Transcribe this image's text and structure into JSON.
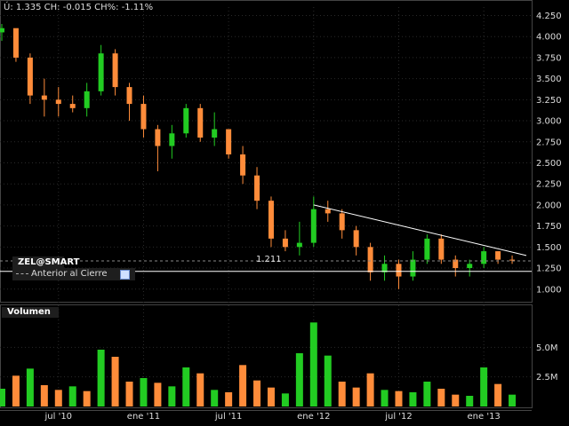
{
  "header": {
    "info_text": "Ú: 1.335 CH: -0.015 CH%: -1.11%"
  },
  "price_panel": {
    "symbol": "ZEL@SMART",
    "legend_label": "Anterior al Cierre",
    "prev_close_value": "1.211"
  },
  "volume_panel": {
    "title": "Volumen"
  },
  "colors": {
    "up": "#22cc22",
    "down": "#ff8c3a",
    "grid": "#2a2a2a",
    "trendline": "#ffffff"
  },
  "chart_data": [
    {
      "type": "candlestick",
      "title": "",
      "ylim": [
        0.85,
        4.35
      ],
      "y_ticks": [
        "1.000",
        "1.250",
        "1.500",
        "1.750",
        "2.000",
        "2.250",
        "2.500",
        "2.750",
        "3.000",
        "3.250",
        "3.500",
        "3.750",
        "4.000",
        "4.250"
      ],
      "x_ticks": [
        "jul '10",
        "ene '11",
        "jul '11",
        "ene '12",
        "jul '12",
        "ene '13"
      ],
      "x_range": [
        "2010-03",
        "2013-04"
      ],
      "previous_close": 1.211,
      "close_reference_line": 1.335,
      "trendline": [
        [
          "2012-01",
          2.0
        ],
        [
          "2013-04",
          1.4
        ]
      ],
      "series": [
        {
          "values": [
            {
              "x": "2010-03",
              "o": 4.05,
              "h": 4.15,
              "l": 3.95,
              "c": 4.1
            },
            {
              "x": "2010-04",
              "o": 4.1,
              "h": 4.05,
              "l": 3.7,
              "c": 3.75
            },
            {
              "x": "2010-05",
              "o": 3.75,
              "h": 3.8,
              "l": 3.2,
              "c": 3.3
            },
            {
              "x": "2010-06",
              "o": 3.3,
              "h": 3.5,
              "l": 3.05,
              "c": 3.25
            },
            {
              "x": "2010-07",
              "o": 3.25,
              "h": 3.4,
              "l": 3.05,
              "c": 3.2
            },
            {
              "x": "2010-08",
              "o": 3.2,
              "h": 3.3,
              "l": 3.1,
              "c": 3.15
            },
            {
              "x": "2010-09",
              "o": 3.15,
              "h": 3.45,
              "l": 3.05,
              "c": 3.35
            },
            {
              "x": "2010-10",
              "o": 3.35,
              "h": 3.9,
              "l": 3.3,
              "c": 3.8
            },
            {
              "x": "2010-11",
              "o": 3.8,
              "h": 3.85,
              "l": 3.3,
              "c": 3.4
            },
            {
              "x": "2010-12",
              "o": 3.4,
              "h": 3.45,
              "l": 3.0,
              "c": 3.2
            },
            {
              "x": "2011-01",
              "o": 3.2,
              "h": 3.3,
              "l": 2.8,
              "c": 2.9
            },
            {
              "x": "2011-02",
              "o": 2.9,
              "h": 2.95,
              "l": 2.4,
              "c": 2.7
            },
            {
              "x": "2011-03",
              "o": 2.7,
              "h": 2.95,
              "l": 2.55,
              "c": 2.85
            },
            {
              "x": "2011-04",
              "o": 2.85,
              "h": 3.2,
              "l": 2.8,
              "c": 3.15
            },
            {
              "x": "2011-05",
              "o": 3.15,
              "h": 3.2,
              "l": 2.75,
              "c": 2.8
            },
            {
              "x": "2011-06",
              "o": 2.8,
              "h": 3.1,
              "l": 2.7,
              "c": 2.9
            },
            {
              "x": "2011-07",
              "o": 2.9,
              "h": 2.9,
              "l": 2.55,
              "c": 2.6
            },
            {
              "x": "2011-08",
              "o": 2.6,
              "h": 2.7,
              "l": 2.25,
              "c": 2.35
            },
            {
              "x": "2011-09",
              "o": 2.35,
              "h": 2.45,
              "l": 1.95,
              "c": 2.05
            },
            {
              "x": "2011-10",
              "o": 2.05,
              "h": 2.1,
              "l": 1.5,
              "c": 1.6
            },
            {
              "x": "2011-11",
              "o": 1.6,
              "h": 1.7,
              "l": 1.45,
              "c": 1.5
            },
            {
              "x": "2011-12",
              "o": 1.5,
              "h": 1.8,
              "l": 1.4,
              "c": 1.55
            },
            {
              "x": "2012-01",
              "o": 1.55,
              "h": 2.1,
              "l": 1.5,
              "c": 1.95
            },
            {
              "x": "2012-02",
              "o": 1.95,
              "h": 2.05,
              "l": 1.8,
              "c": 1.9
            },
            {
              "x": "2012-03",
              "o": 1.9,
              "h": 1.95,
              "l": 1.6,
              "c": 1.7
            },
            {
              "x": "2012-04",
              "o": 1.7,
              "h": 1.75,
              "l": 1.4,
              "c": 1.5
            },
            {
              "x": "2012-05",
              "o": 1.5,
              "h": 1.55,
              "l": 1.1,
              "c": 1.2
            },
            {
              "x": "2012-06",
              "o": 1.2,
              "h": 1.4,
              "l": 1.1,
              "c": 1.3
            },
            {
              "x": "2012-07",
              "o": 1.3,
              "h": 1.35,
              "l": 1.0,
              "c": 1.15
            },
            {
              "x": "2012-08",
              "o": 1.15,
              "h": 1.45,
              "l": 1.1,
              "c": 1.35
            },
            {
              "x": "2012-09",
              "o": 1.35,
              "h": 1.65,
              "l": 1.3,
              "c": 1.6
            },
            {
              "x": "2012-10",
              "o": 1.6,
              "h": 1.65,
              "l": 1.3,
              "c": 1.35
            },
            {
              "x": "2012-11",
              "o": 1.35,
              "h": 1.4,
              "l": 1.15,
              "c": 1.25
            },
            {
              "x": "2012-12",
              "o": 1.25,
              "h": 1.35,
              "l": 1.15,
              "c": 1.3
            },
            {
              "x": "2013-01",
              "o": 1.3,
              "h": 1.5,
              "l": 1.25,
              "c": 1.45
            },
            {
              "x": "2013-02",
              "o": 1.45,
              "h": 1.45,
              "l": 1.3,
              "c": 1.35
            },
            {
              "x": "2013-03",
              "o": 1.35,
              "h": 1.4,
              "l": 1.3,
              "c": 1.34
            }
          ]
        }
      ]
    },
    {
      "type": "bar",
      "title": "Volumen",
      "y_ticks": [
        "2.5M",
        "5.0M"
      ],
      "ylim": [
        0,
        7500000
      ],
      "series": [
        {
          "values": [
            {
              "x": "2010-03",
              "v": 1500000,
              "up": true
            },
            {
              "x": "2010-04",
              "v": 2600000,
              "up": false
            },
            {
              "x": "2010-05",
              "v": 3200000,
              "up": true
            },
            {
              "x": "2010-06",
              "v": 1800000,
              "up": false
            },
            {
              "x": "2010-07",
              "v": 1400000,
              "up": false
            },
            {
              "x": "2010-08",
              "v": 1700000,
              "up": true
            },
            {
              "x": "2010-09",
              "v": 1300000,
              "up": false
            },
            {
              "x": "2010-10",
              "v": 4800000,
              "up": true
            },
            {
              "x": "2010-11",
              "v": 4200000,
              "up": false
            },
            {
              "x": "2010-12",
              "v": 2100000,
              "up": false
            },
            {
              "x": "2011-01",
              "v": 2400000,
              "up": true
            },
            {
              "x": "2011-02",
              "v": 2000000,
              "up": false
            },
            {
              "x": "2011-03",
              "v": 1700000,
              "up": true
            },
            {
              "x": "2011-04",
              "v": 3300000,
              "up": true
            },
            {
              "x": "2011-05",
              "v": 2800000,
              "up": false
            },
            {
              "x": "2011-06",
              "v": 1400000,
              "up": true
            },
            {
              "x": "2011-07",
              "v": 1200000,
              "up": false
            },
            {
              "x": "2011-08",
              "v": 3500000,
              "up": false
            },
            {
              "x": "2011-09",
              "v": 2200000,
              "up": false
            },
            {
              "x": "2011-10",
              "v": 1600000,
              "up": false
            },
            {
              "x": "2011-11",
              "v": 1100000,
              "up": true
            },
            {
              "x": "2011-12",
              "v": 4500000,
              "up": true
            },
            {
              "x": "2012-01",
              "v": 7100000,
              "up": true
            },
            {
              "x": "2012-02",
              "v": 4300000,
              "up": true
            },
            {
              "x": "2012-03",
              "v": 2100000,
              "up": false
            },
            {
              "x": "2012-04",
              "v": 1600000,
              "up": false
            },
            {
              "x": "2012-05",
              "v": 2800000,
              "up": false
            },
            {
              "x": "2012-06",
              "v": 1400000,
              "up": true
            },
            {
              "x": "2012-07",
              "v": 1300000,
              "up": false
            },
            {
              "x": "2012-08",
              "v": 1200000,
              "up": true
            },
            {
              "x": "2012-09",
              "v": 2100000,
              "up": true
            },
            {
              "x": "2012-10",
              "v": 1500000,
              "up": false
            },
            {
              "x": "2012-11",
              "v": 1000000,
              "up": false
            },
            {
              "x": "2012-12",
              "v": 900000,
              "up": true
            },
            {
              "x": "2013-01",
              "v": 3300000,
              "up": true
            },
            {
              "x": "2013-02",
              "v": 1900000,
              "up": false
            },
            {
              "x": "2013-03",
              "v": 1000000,
              "up": true
            }
          ]
        }
      ]
    }
  ]
}
